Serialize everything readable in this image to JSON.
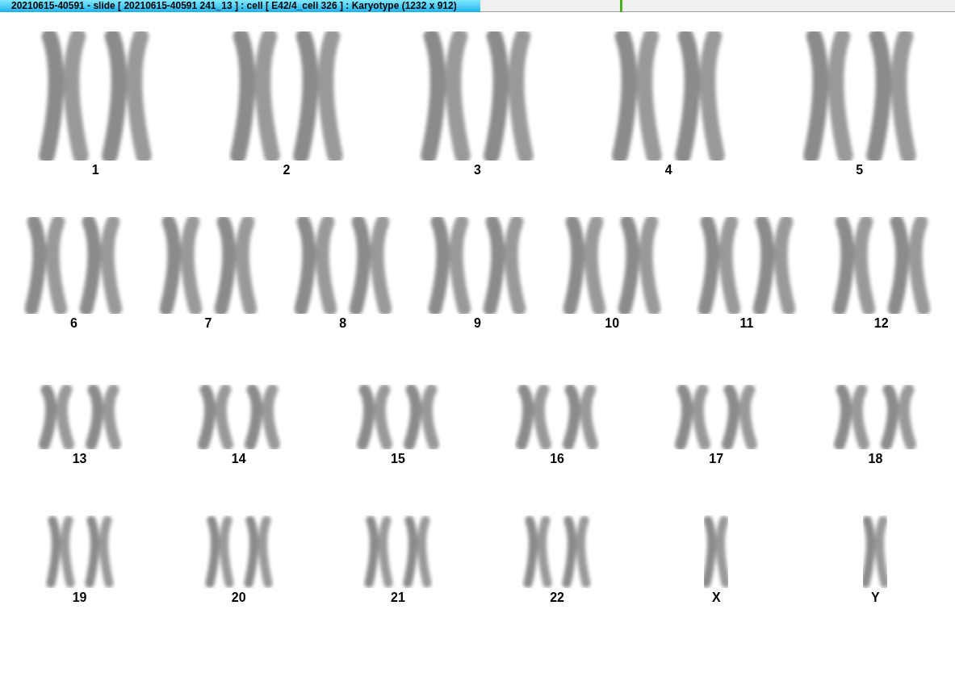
{
  "window": {
    "title": "20210615-40591 - slide [ 20210615-40591 241_13 ] : cell [ E42/4_cell 326 ] : Karyotype  (1232 x 912)"
  },
  "karyotype": {
    "rows": [
      {
        "items": [
          {
            "label": "1",
            "kind": "pair"
          },
          {
            "label": "2",
            "kind": "pair"
          },
          {
            "label": "3",
            "kind": "pair"
          },
          {
            "label": "4",
            "kind": "pair"
          },
          {
            "label": "5",
            "kind": "pair"
          }
        ]
      },
      {
        "items": [
          {
            "label": "6",
            "kind": "pair"
          },
          {
            "label": "7",
            "kind": "pair"
          },
          {
            "label": "8",
            "kind": "pair"
          },
          {
            "label": "9",
            "kind": "pair"
          },
          {
            "label": "10",
            "kind": "pair"
          },
          {
            "label": "11",
            "kind": "pair"
          },
          {
            "label": "12",
            "kind": "pair"
          }
        ]
      },
      {
        "items": [
          {
            "label": "13",
            "kind": "pair"
          },
          {
            "label": "14",
            "kind": "pair"
          },
          {
            "label": "15",
            "kind": "pair"
          },
          {
            "label": "16",
            "kind": "pair"
          },
          {
            "label": "17",
            "kind": "pair"
          },
          {
            "label": "18",
            "kind": "pair"
          }
        ]
      },
      {
        "items": [
          {
            "label": "19",
            "kind": "pair"
          },
          {
            "label": "20",
            "kind": "pair"
          },
          {
            "label": "21",
            "kind": "pair"
          },
          {
            "label": "22",
            "kind": "pair"
          },
          {
            "label": "X",
            "kind": "single"
          },
          {
            "label": "Y",
            "kind": "single"
          }
        ]
      }
    ]
  }
}
